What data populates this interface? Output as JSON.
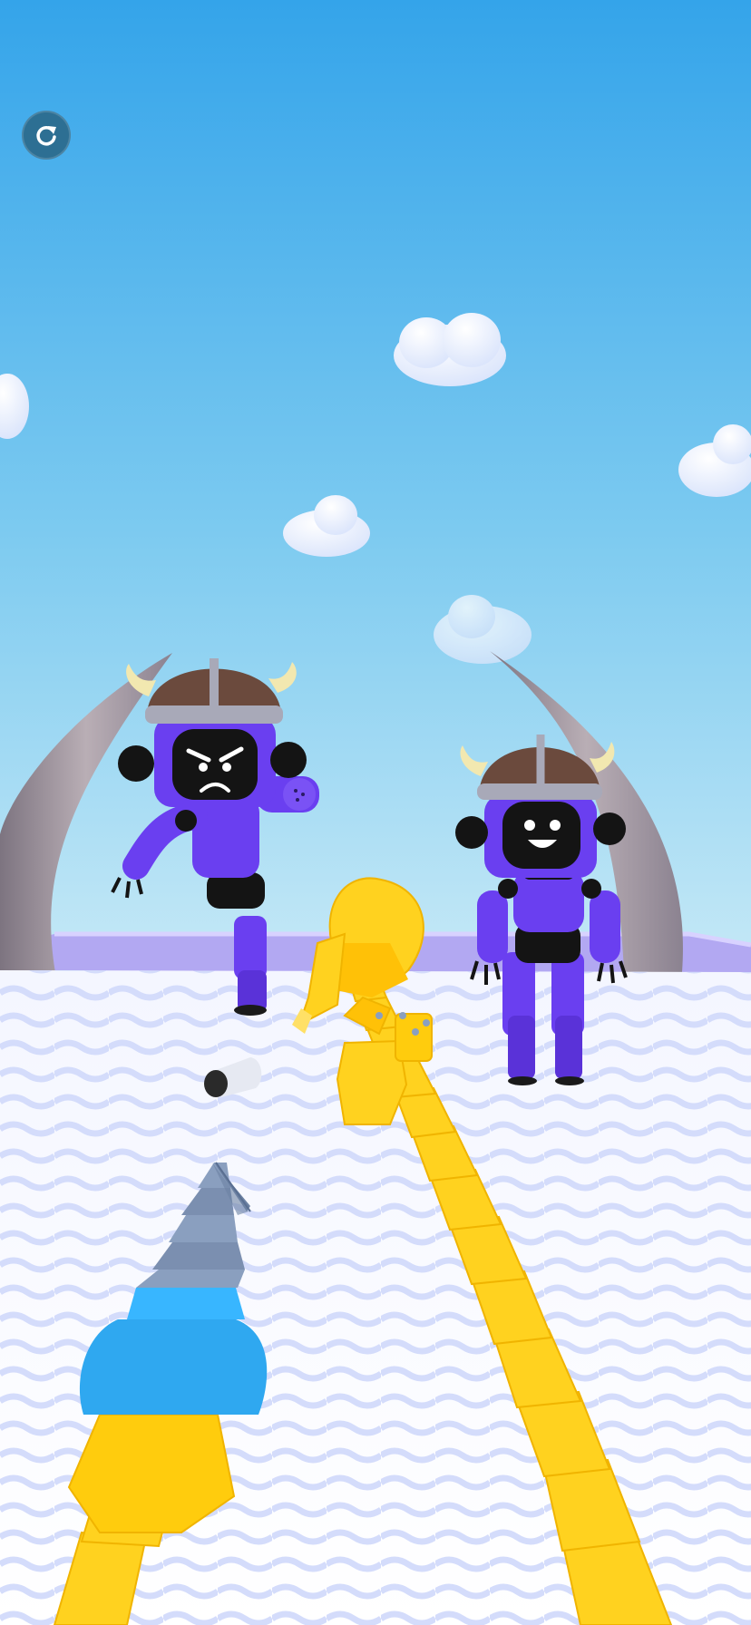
{
  "game": {
    "restart_button": {
      "icon": "restart-icon"
    },
    "colors": {
      "sky_top": "#34a4ea",
      "sky_bottom": "#bfe6f6",
      "floor": "#ffffff",
      "wave": "#d9e2ff",
      "rail": "#a99ef0",
      "robot_body": "#6a3ff0",
      "robot_dark": "#141414",
      "helmet": "#6b4a3d",
      "horn": "#f2e8b0",
      "tusk": "#9a8f99",
      "player_chain": "#ffd21f",
      "drill_blue": "#2fa8f0",
      "drill_tip": "#8a9fbf"
    },
    "enemies": [
      {
        "name": "viking-robot-angry",
        "face": "angry"
      },
      {
        "name": "viking-robot-smiling",
        "face": "smiling"
      }
    ]
  }
}
